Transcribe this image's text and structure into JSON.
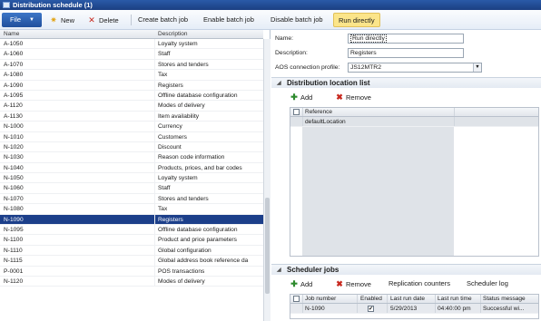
{
  "window": {
    "title": "Distribution schedule (1)"
  },
  "toolbar": {
    "file_label": "File",
    "new_label": "New",
    "delete_label": "Delete",
    "create_batch_label": "Create batch job",
    "enable_batch_label": "Enable batch job",
    "disable_batch_label": "Disable batch job",
    "run_directly_label": "Run directly"
  },
  "grid": {
    "columns": [
      "Name",
      "Description"
    ],
    "rows": [
      {
        "name": "A-1050",
        "description": "Loyalty system"
      },
      {
        "name": "A-1060",
        "description": "Staff"
      },
      {
        "name": "A-1070",
        "description": "Stores and tenders"
      },
      {
        "name": "A-1080",
        "description": "Tax"
      },
      {
        "name": "A-1090",
        "description": "Registers"
      },
      {
        "name": "A-1095",
        "description": "Offline database configuration"
      },
      {
        "name": "A-1120",
        "description": "Modes of delivery"
      },
      {
        "name": "A-1130",
        "description": "Item availability"
      },
      {
        "name": "N-1000",
        "description": "Currency"
      },
      {
        "name": "N-1010",
        "description": "Customers"
      },
      {
        "name": "N-1020",
        "description": "Discount"
      },
      {
        "name": "N-1030",
        "description": "Reason code information"
      },
      {
        "name": "N-1040",
        "description": "Products, prices, and bar codes"
      },
      {
        "name": "N-1050",
        "description": "Loyalty system"
      },
      {
        "name": "N-1060",
        "description": "Staff"
      },
      {
        "name": "N-1070",
        "description": "Stores and tenders"
      },
      {
        "name": "N-1080",
        "description": "Tax"
      },
      {
        "name": "N-1090",
        "description": "Registers"
      },
      {
        "name": "N-1095",
        "description": "Offline database configuration"
      },
      {
        "name": "N-1100",
        "description": "Product and price parameters"
      },
      {
        "name": "N-1110",
        "description": "Global configuration"
      },
      {
        "name": "N-1115",
        "description": "Global address book reference da"
      },
      {
        "name": "P-0001",
        "description": "POS transactions"
      },
      {
        "name": "N-1120",
        "description": "Modes of delivery"
      }
    ],
    "selected_index": 17
  },
  "form": {
    "name_label": "Name:",
    "name_value": "Run directly",
    "description_label": "Description:",
    "description_value": "Registers",
    "aos_label": "AOS connection profile:",
    "aos_value": "JS12MTR2"
  },
  "distribution_section": {
    "title": "Distribution location list",
    "add_label": "Add",
    "remove_label": "Remove",
    "column_reference": "Reference",
    "rows": [
      "defaultLocation"
    ]
  },
  "scheduler_section": {
    "title": "Scheduler jobs",
    "add_label": "Add",
    "remove_label": "Remove",
    "replication_counters_label": "Replication counters",
    "scheduler_log_label": "Scheduler log",
    "columns": [
      "Job number",
      "Enabled",
      "Last run date",
      "Last run time",
      "Status message"
    ],
    "rows": [
      {
        "job_number": "N-1090",
        "enabled": "✔",
        "last_run_date": "5/29/2013",
        "last_run_time": "04:40:00 pm",
        "status_message": "Successful wi..."
      }
    ]
  }
}
